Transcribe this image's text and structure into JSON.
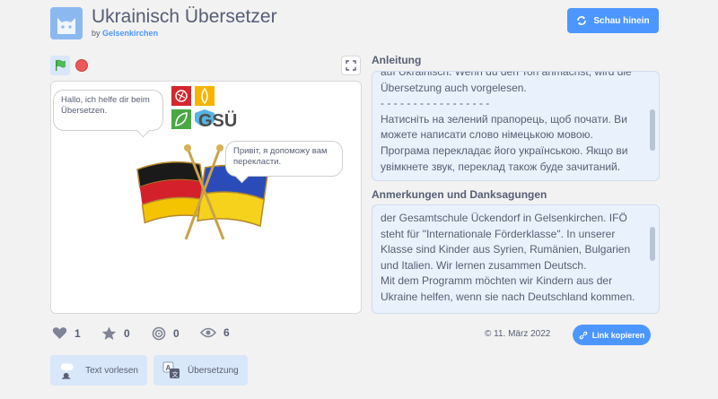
{
  "header": {
    "title": "Ukrainisch Übersetzer",
    "by_prefix": "by",
    "author": "Gelsenkirchen",
    "see_inside_label": "Schau hinein"
  },
  "player": {
    "green_flag_icon": "green-flag-icon",
    "stop_icon": "stop-icon",
    "fullscreen_icon": "fullscreen-icon"
  },
  "stage": {
    "bubble_german": "Hallo, ich helfe dir beim Übersetzen.",
    "bubble_ukrainian": "Привіт, я допоможу вам перекласти.",
    "logo_text": "GSÜ"
  },
  "instructions": {
    "heading": "Anleitung",
    "text": "auf Ukrainisch. Wenn du den Ton anmachst, wird die Übersetzung auch vorgelesen.\n- - - - - - - - - - - - - - - - -\nНатисніть на зелений прапорець, щоб почати. Ви можете написати слово німецькою мовою. Програма перекладає його українською. Якщо ви увімкнете звук, переклад також буде зачитаний."
  },
  "notes": {
    "heading": "Anmerkungen und Danksagungen",
    "text": "der Gesamtschule Ückendorf in Gelsenkirchen. IFÖ steht für \"Internationale Förderklasse\". In unserer Klasse sind Kinder aus Syrien, Rumänien, Bulgarien und Italien. Wir lernen zusammen Deutsch.\nMit dem Programm möchten wir Kindern aus der Ukraine helfen, wenn sie nach Deutschland kommen.\n- - - - - - - - - - - - -"
  },
  "stats": {
    "loves": "1",
    "favorites": "0",
    "remixes": "0",
    "views": "6"
  },
  "footer": {
    "date": "11. März 2022",
    "copy_link_label": "Link kopieren"
  },
  "extensions": [
    {
      "label": "Text vorlesen",
      "icon": "text-to-speech-icon"
    },
    {
      "label": "Übersetzung",
      "icon": "translate-icon"
    }
  ],
  "colors": {
    "accent": "#4c97ff",
    "text": "#575e75",
    "background": "#f2f2f2",
    "panel": "#e9f1fc",
    "stop": "#ec5959",
    "flag": "#4cbf56"
  }
}
